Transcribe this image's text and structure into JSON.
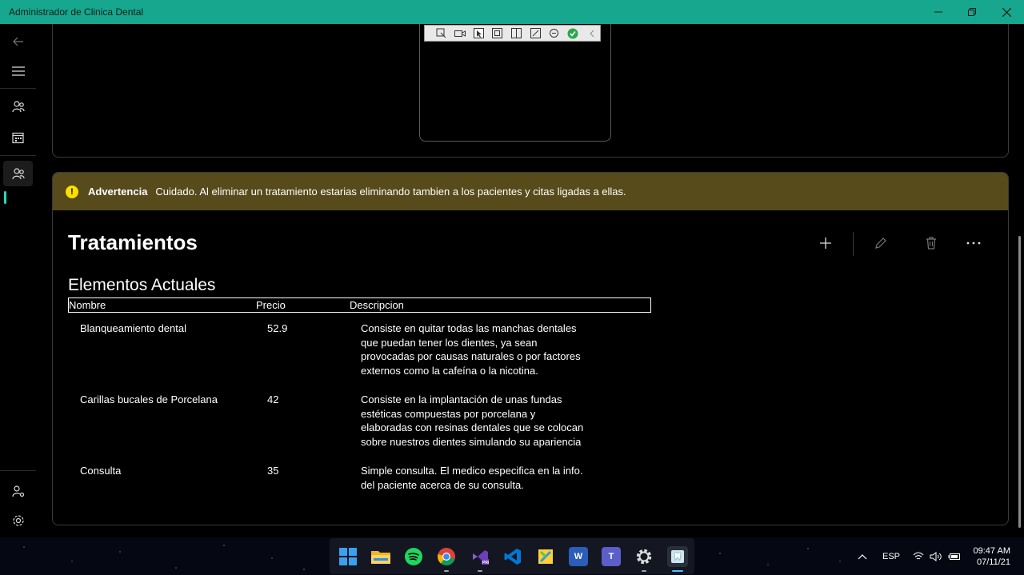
{
  "window": {
    "title": "Administrador de Clinica Dental"
  },
  "nav": {
    "items": [
      "back-arrow-icon",
      "hamburger-menu-icon",
      "patients-icon",
      "calendar-icon",
      "treatments-icon",
      "account-settings-icon",
      "settings-icon"
    ]
  },
  "warning": {
    "title": "Advertencia",
    "message": "Cuidado. Al eliminar un tratamiento estarias eliminando tambien a los pacientes y citas ligadas a ellas."
  },
  "page": {
    "title": "Tratamientos",
    "subtitle": "Elementos Actuales"
  },
  "table": {
    "headers": [
      "Nombre",
      "Precio",
      "Descripcion"
    ],
    "rows": [
      {
        "name": "Blanqueamiento dental",
        "price": "52.9",
        "description": "Consiste en quitar todas las manchas dentales que puedan tener los dientes, ya sean provocadas por causas naturales o por factores externos como la cafeína o la nicotina."
      },
      {
        "name": "Carillas bucales de Porcelana",
        "price": "42",
        "description": "Consiste en la implantación de unas fundas estéticas compuestas por porcelana y elaboradas con resinas dentales que se colocan sobre nuestros dientes simulando su apariencia"
      },
      {
        "name": "Consulta",
        "price": "35",
        "description": "Simple consulta. El medico especifica en la info. del paciente acerca de su consulta."
      }
    ]
  },
  "taskbar": {
    "apps": [
      {
        "name": "start",
        "icon": "windows-icon"
      },
      {
        "name": "files",
        "icon": "file-explorer-icon"
      },
      {
        "name": "spotify",
        "icon": "spotify-icon"
      },
      {
        "name": "chrome",
        "icon": "chrome-icon"
      },
      {
        "name": "visual-studio",
        "icon": "visual-studio-icon"
      },
      {
        "name": "vscode",
        "icon": "vscode-icon"
      },
      {
        "name": "teams-pro",
        "icon": "app-icon"
      },
      {
        "name": "word",
        "icon": "word-icon",
        "label": "W"
      },
      {
        "name": "teams",
        "icon": "teams-icon",
        "label": "T"
      },
      {
        "name": "settings",
        "icon": "settings-icon"
      },
      {
        "name": "dental-app",
        "icon": "dental-app-icon"
      }
    ],
    "language": "ESP",
    "time": "09:47 AM",
    "date": "07/11/21"
  },
  "colors": {
    "accent": "#17a68e",
    "warning_bg": "#574b1c",
    "warning_icon": "#fce100"
  }
}
